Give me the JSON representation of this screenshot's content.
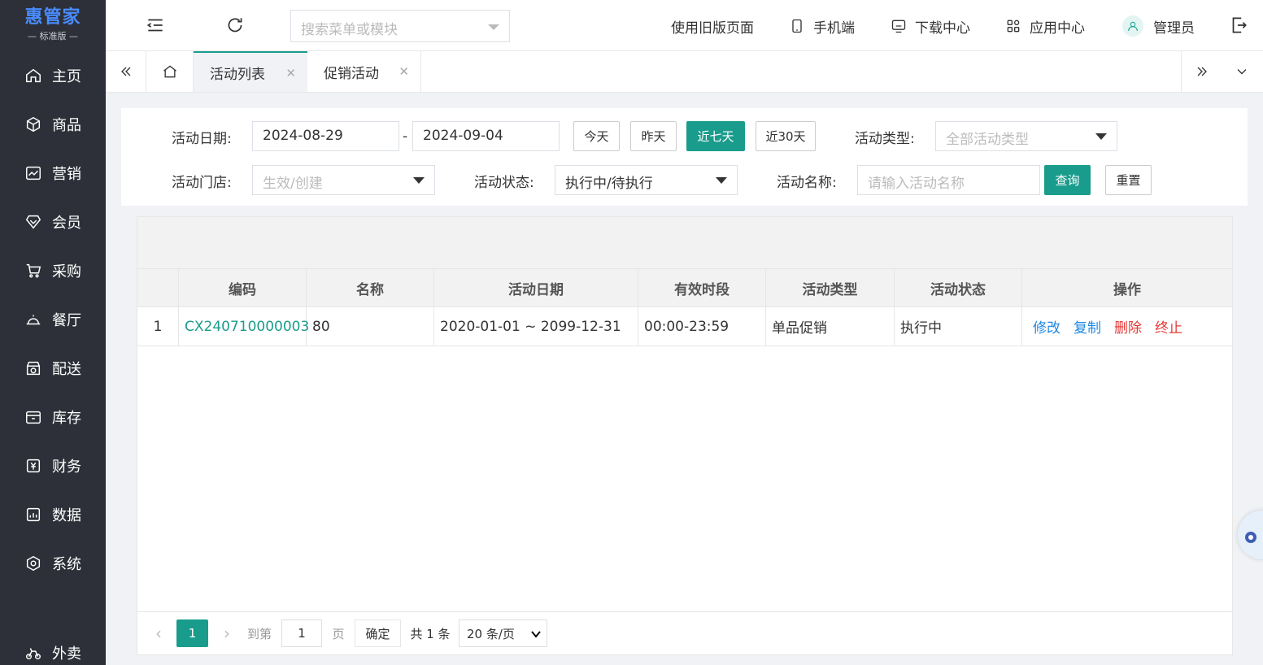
{
  "brand": {
    "name": "惠管家",
    "edition": "标准版",
    "color": "#4a8cff"
  },
  "sidebar": {
    "items": [
      {
        "label": "主页",
        "icon": "home-icon"
      },
      {
        "label": "商品",
        "icon": "cube-icon"
      },
      {
        "label": "营销",
        "icon": "chart-icon"
      },
      {
        "label": "会员",
        "icon": "diamond-icon"
      },
      {
        "label": "采购",
        "icon": "cart-icon"
      },
      {
        "label": "餐厅",
        "icon": "cloche-icon"
      },
      {
        "label": "配送",
        "icon": "store-icon"
      },
      {
        "label": "库存",
        "icon": "box-icon"
      },
      {
        "label": "财务",
        "icon": "yen-icon"
      },
      {
        "label": "数据",
        "icon": "data-icon"
      },
      {
        "label": "系统",
        "icon": "settings-icon"
      },
      {
        "label": "外卖",
        "icon": "bike-icon"
      }
    ]
  },
  "topbar": {
    "search_placeholder": "搜索菜单或模块",
    "old_version": "使用旧版页面",
    "mobile": "手机端",
    "download": "下载中心",
    "apps": "应用中心",
    "user": "管理员"
  },
  "tabs": [
    {
      "label": "活动列表",
      "active": true
    },
    {
      "label": "促销活动",
      "active": false
    }
  ],
  "filter": {
    "date_label": "活动日期:",
    "date_start": "2024-08-29",
    "date_sep": "-",
    "date_end": "2024-09-04",
    "quick": [
      "今天",
      "昨天",
      "近七天",
      "近30天"
    ],
    "quick_active": "近七天",
    "type_label": "活动类型:",
    "type_placeholder": "全部活动类型",
    "store_label": "活动门店:",
    "store_placeholder": "生效/创建",
    "status_label": "活动状态:",
    "status_value": "执行中/待执行",
    "name_label": "活动名称:",
    "name_placeholder": "请输入活动名称",
    "search_btn": "查询",
    "reset_btn": "重置"
  },
  "table": {
    "columns": [
      "编码",
      "名称",
      "活动日期",
      "有效时段",
      "活动类型",
      "活动状态",
      "操作"
    ],
    "rows": [
      {
        "index": "1",
        "code": "CX240710000003",
        "name": "80",
        "date": "2020-01-01 ~ 2099-12-31",
        "period": "00:00-23:59",
        "type": "单品促销",
        "status": "执行中"
      }
    ],
    "actions": [
      {
        "label": "修改",
        "color": "#1e88e5"
      },
      {
        "label": "复制",
        "color": "#1e88e5"
      },
      {
        "label": "删除",
        "color": "#e53935"
      },
      {
        "label": "终止",
        "color": "#e53935"
      }
    ]
  },
  "pager": {
    "current": "1",
    "goto_label": "到第",
    "goto_value": "1",
    "page_unit": "页",
    "confirm": "确定",
    "total": "共 1 条",
    "page_size": "20 条/页"
  },
  "colors": {
    "primary": "#1a9c8c",
    "sidebar": "#2d3038",
    "link": "#1e88e5",
    "danger": "#e53935"
  }
}
